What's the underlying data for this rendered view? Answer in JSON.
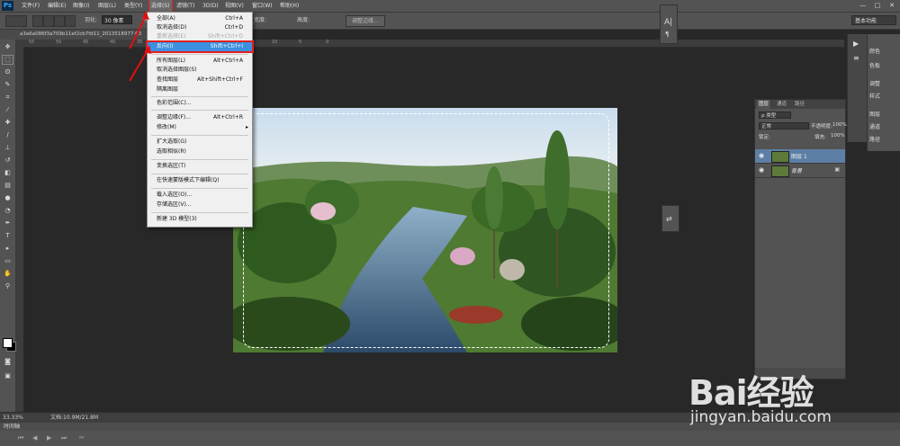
{
  "app": {
    "logo": "Ps"
  },
  "menubar": {
    "items": [
      "文件(F)",
      "编辑(E)",
      "图像(I)",
      "图层(L)",
      "类型(Y)",
      "选择(S)",
      "滤镜(T)",
      "3D(D)",
      "视图(V)",
      "窗口(W)",
      "帮助(H)"
    ],
    "active_index": 5
  },
  "window_controls": [
    "—",
    "□",
    "✕"
  ],
  "options": {
    "feather_label": "羽化:",
    "feather_value": "30 像素",
    "antialias_label": "消除锯齿",
    "style_label": "样式:",
    "width_label": "宽度:",
    "height_label": "高度:",
    "refine_button": "调整边缘...",
    "workspace": "基本功能"
  },
  "document": {
    "tab_title": "a3a6a086f3a709b11ef2cb7fd11_2013518977·63"
  },
  "ruler": {
    "top_numbers": [
      "55",
      "50",
      "45",
      "40",
      "35",
      "30",
      "25",
      "20",
      "15",
      "10",
      "5",
      "0"
    ]
  },
  "select_menu": {
    "items": [
      {
        "label": "全部(A)",
        "shortcut": "Ctrl+A"
      },
      {
        "label": "取消选择(D)",
        "shortcut": "Ctrl+D"
      },
      {
        "label": "重新选择(E)",
        "shortcut": "Shift+Ctrl+D",
        "disabled": true
      },
      {
        "label": "反向(I)",
        "shortcut": "Shift+Ctrl+I",
        "highlighted": true
      },
      {
        "label": "所有图层(L)",
        "shortcut": "Alt+Ctrl+A"
      },
      {
        "label": "取消选择图层(S)",
        "shortcut": ""
      },
      {
        "label": "查找图层",
        "shortcut": "Alt+Shift+Ctrl+F"
      },
      {
        "label": "隔离图层",
        "shortcut": ""
      },
      {
        "label": "色彩范围(C)...",
        "shortcut": ""
      },
      {
        "label": "调整边缘(F)...",
        "shortcut": "Alt+Ctrl+R"
      },
      {
        "label": "修改(M)",
        "shortcut": ""
      },
      {
        "label": "扩大选取(G)",
        "shortcut": ""
      },
      {
        "label": "选取相似(R)",
        "shortcut": ""
      },
      {
        "label": "变换选区(T)",
        "shortcut": ""
      },
      {
        "label": "在快速蒙版模式下编辑(Q)",
        "shortcut": ""
      },
      {
        "label": "载入选区(O)...",
        "shortcut": ""
      },
      {
        "label": "存储选区(V)...",
        "shortcut": ""
      },
      {
        "label": "新建 3D 模型(3)",
        "shortcut": ""
      }
    ]
  },
  "right_panel_labels": [
    "颜色",
    "色板",
    "调整",
    "样式",
    "图层",
    "通道",
    "路径"
  ],
  "layers": {
    "tabs": [
      "图层",
      "通道",
      "路径"
    ],
    "kind_filter": "ρ 类型",
    "blend_mode": "正常",
    "opacity_label": "不透明度:",
    "opacity_value": "100%",
    "lock_label": "锁定:",
    "fill_label": "填充:",
    "fill_value": "100%",
    "items": [
      {
        "name": "图层 1",
        "selected": true
      },
      {
        "name": "背景",
        "locked": true
      }
    ]
  },
  "status": {
    "zoom": "33.33%",
    "doc_info": "文档:10.9M/21.8M",
    "timeline_label": "时间轴"
  },
  "watermark": {
    "brand": "Bai经验",
    "url": "jingyan.baidu.com"
  }
}
